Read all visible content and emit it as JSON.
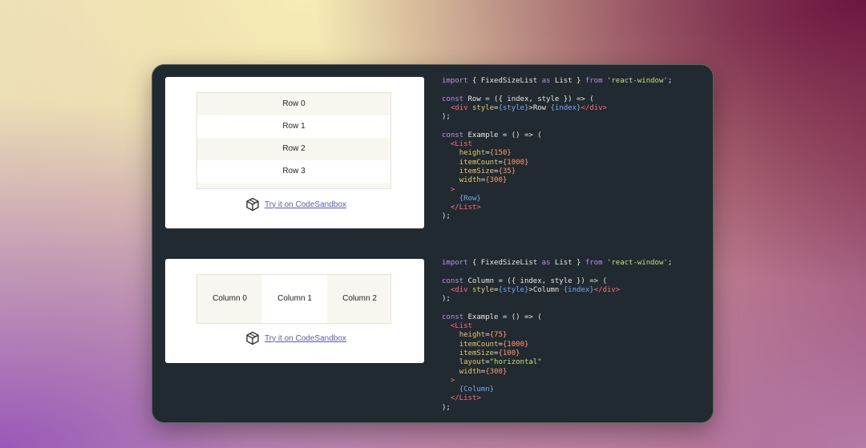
{
  "example1": {
    "rows": [
      "Row 0",
      "Row 1",
      "Row 2",
      "Row 3"
    ],
    "sandbox_link": "Try it on CodeSandbox",
    "code": {
      "import_kw": "import",
      "import_names": "{ FixedSizeList",
      "as_kw": "as",
      "list_name": "List }",
      "from_kw": "from",
      "module": "'react-window'",
      "semicolon": ";",
      "const_kw": "const",
      "row_decl": "Row = ({ index, style }) => (",
      "div_open": "<div",
      "style_attr": "style",
      "style_val": "{style}",
      "row_text": ">Row ",
      "index_val": "{index}",
      "div_close": "</div>",
      "close_paren": ");",
      "example_decl": "Example = () => (",
      "list_open": "<List",
      "height_attr": "height",
      "height_val": "{150}",
      "count_attr": "itemCount",
      "count_val": "{1000}",
      "size_attr": "itemSize",
      "size_val": "{35}",
      "width_attr": "width",
      "width_val": "{300}",
      "gt": ">",
      "child": "{Row}",
      "list_close": "</List>"
    }
  },
  "example2": {
    "columns": [
      "Column 0",
      "Column 1",
      "Column 2"
    ],
    "sandbox_link": "Try it on CodeSandbox",
    "code": {
      "import_kw": "import",
      "import_names": "{ FixedSizeList",
      "as_kw": "as",
      "list_name": "List }",
      "from_kw": "from",
      "module": "'react-window'",
      "semicolon": ";",
      "const_kw": "const",
      "col_decl": "Column = ({ index, style }) => (",
      "div_open": "<div",
      "style_attr": "style",
      "style_val": "{style}",
      "col_text": ">Column ",
      "index_val": "{index}",
      "div_close": "</div>",
      "close_paren": ");",
      "example_decl": "Example = () => (",
      "list_open": "<List",
      "height_attr": "height",
      "height_val": "{75}",
      "count_attr": "itemCount",
      "count_val": "{1000}",
      "size_attr": "itemSize",
      "size_val": "{100}",
      "layout_attr": "layout",
      "layout_val": "\"horizontal\"",
      "width_attr": "width",
      "width_val": "{300}",
      "gt": ">",
      "child": "{Column}",
      "list_close": "</List>"
    }
  },
  "colors": {
    "panel_bg": "#222a31",
    "keyword": "#b98fe0",
    "string": "#c4de80",
    "tag": "#ff6a7f",
    "attr": "#e6c66c",
    "number": "#ff9a6e",
    "variable": "#7aa8ee",
    "link": "#5a5ba6"
  }
}
